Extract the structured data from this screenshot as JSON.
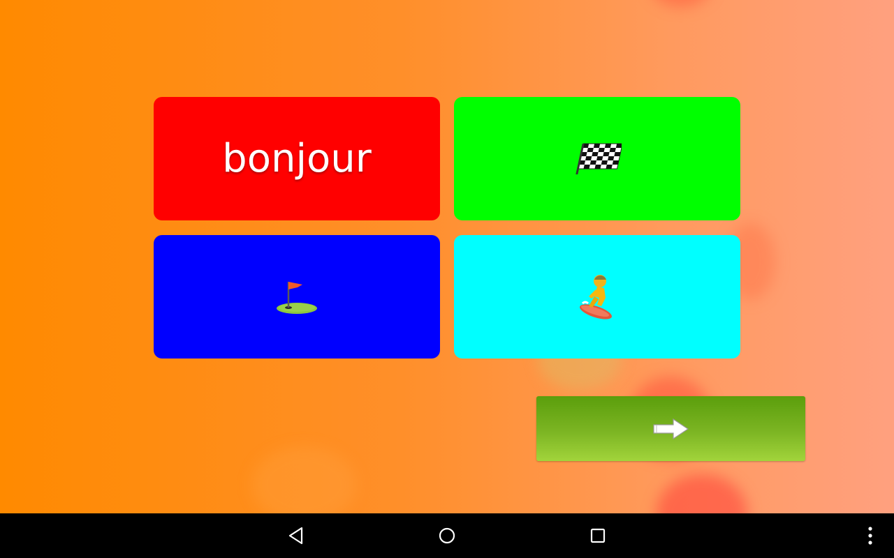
{
  "screen": {
    "background": "#ff8a00"
  },
  "tiles": [
    {
      "kind": "word",
      "text": "bonjour",
      "color": "#ff0000"
    },
    {
      "kind": "icon",
      "icon": "checkered-flag-icon",
      "color": "#00ff00"
    },
    {
      "kind": "icon",
      "icon": "golf-flag-icon",
      "color": "#0000ff"
    },
    {
      "kind": "icon",
      "icon": "snowboarder-icon",
      "color": "#00ffff"
    }
  ],
  "next_button": {
    "icon": "right-arrow-icon",
    "color": "#7cb523"
  },
  "system_nav": {
    "back_icon": "back-triangle-icon",
    "home_icon": "home-circle-icon",
    "recents_icon": "recents-square-icon",
    "menu_icon": "overflow-menu-icon"
  }
}
